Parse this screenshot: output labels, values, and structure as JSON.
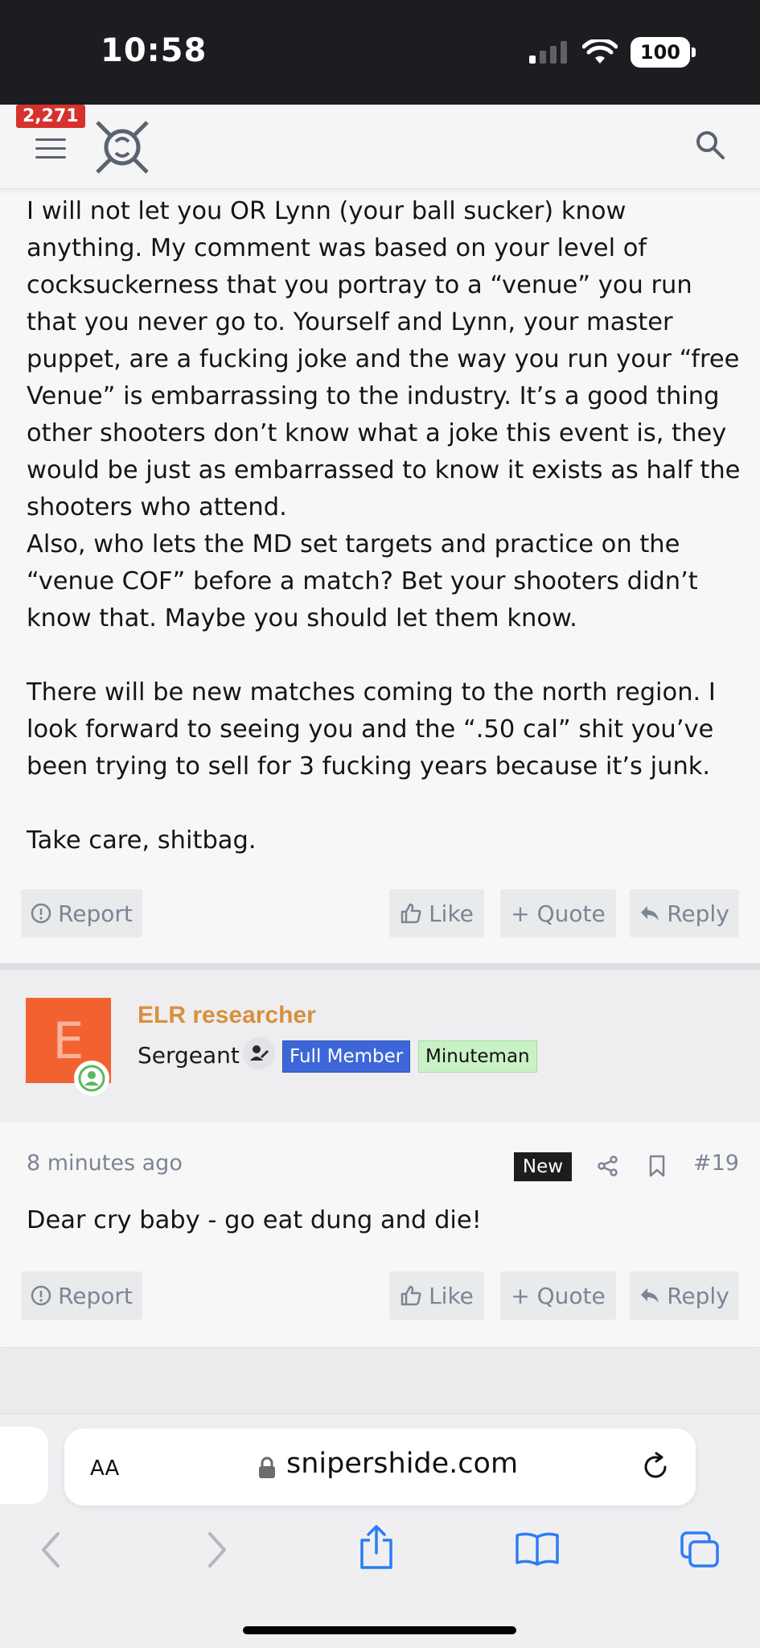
{
  "status_bar": {
    "time": "10:58",
    "battery": "100"
  },
  "header": {
    "notifications": "2,271"
  },
  "post1": {
    "body": "I will not let you OR Lynn (your ball sucker) know anything. My comment was based on your level of cocksuckerness that you portray to a “venue” you run that you never go to. Yourself and Lynn, your master puppet, are a fucking joke and the way you run your “free Venue” is embarrassing to the industry. It’s a good thing other shooters don’t know what a joke this event is, they would be just as embarrassed to know it exists as half the shooters who attend.\nAlso, who lets the MD set targets and practice on the “venue COF” before a match? Bet your shooters didn’t know that. Maybe you should let them know.\n\nThere will be new matches coming to the north region. I look forward to seeing you and the “.50 cal” shit you’ve been trying to sell for 3 fucking years because it’s junk.\n\nTake care, shitbag.",
    "actions": {
      "report": "Report",
      "like": "Like",
      "quote": "+ Quote",
      "reply": "Reply"
    }
  },
  "post2": {
    "avatar_letter": "E",
    "username": "ELR researcher",
    "user_title": "Sergeant",
    "badges": [
      "Full Member",
      "Minuteman"
    ],
    "time": "8 minutes ago",
    "new_label": "New",
    "post_number": "#19",
    "body": "Dear cry baby - go eat dung and die!",
    "actions": {
      "report": "Report",
      "like": "Like",
      "quote": "+ Quote",
      "reply": "Reply"
    }
  },
  "browser": {
    "text_size": "AA",
    "url": "snipershide.com"
  },
  "colors": {
    "accent_username": "#d9903c",
    "avatar_bg": "#f26230",
    "badge_full_member": "#3d67d8",
    "badge_minuteman": "#c9f1c6",
    "notification": "#d6312c",
    "ios_blue": "#2d7cf6"
  },
  "icons": [
    "menu-icon",
    "logo-icon",
    "search-icon",
    "report-icon",
    "like-icon",
    "reply-icon",
    "share-icon",
    "bookmark-icon",
    "lock-icon",
    "reload-icon",
    "back-icon",
    "forward-icon",
    "share-sheet-icon",
    "bookmarks-icon",
    "tabs-icon"
  ]
}
